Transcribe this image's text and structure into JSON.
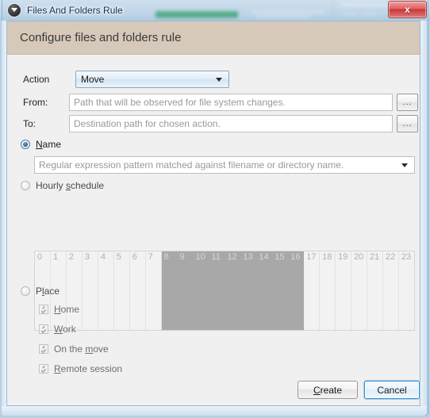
{
  "window": {
    "title": "Files And Folders Rule",
    "icon": "triangle-circle-icon",
    "close_label": "x"
  },
  "banner": {
    "heading": "Configure files and folders rule"
  },
  "form": {
    "action": {
      "label": "Action",
      "value": "Move",
      "options": [
        "Move"
      ]
    },
    "from": {
      "label": "From:",
      "value": "",
      "placeholder": "Path that will be observed for file system changes.",
      "browse_label": "..."
    },
    "to": {
      "label": "To:",
      "value": "",
      "placeholder": "Destination path for chosen action.",
      "browse_label": "..."
    }
  },
  "criteria": {
    "name": {
      "label": "Name",
      "mnemonic": "N",
      "selected": true,
      "pattern_value": "",
      "pattern_placeholder": "Regular expression pattern matched against filename or directory name."
    },
    "hourly": {
      "label_pre": "Hourly ",
      "mnemonic": "s",
      "label_post": "chedule",
      "selected": false,
      "hours": [
        "0",
        "1",
        "2",
        "3",
        "4",
        "5",
        "6",
        "7",
        "8",
        "9",
        "10",
        "11",
        "12",
        "13",
        "14",
        "15",
        "16",
        "17",
        "18",
        "19",
        "20",
        "21",
        "22",
        "23"
      ],
      "selected_hours": [
        8,
        9,
        10,
        11,
        12,
        13,
        14,
        15,
        16
      ]
    },
    "place": {
      "label_pre": "P",
      "mnemonic": "l",
      "label_post": "ace",
      "selected": false,
      "items": [
        {
          "label_pre": "",
          "mnemonic": "H",
          "label_post": "ome",
          "checked": true
        },
        {
          "label_pre": "",
          "mnemonic": "W",
          "label_post": "ork",
          "checked": true
        },
        {
          "label_pre": "On the ",
          "mnemonic": "m",
          "label_post": "ove",
          "checked": true
        },
        {
          "label_pre": "",
          "mnemonic": "R",
          "label_post": "emote session",
          "checked": true
        }
      ]
    }
  },
  "footer": {
    "create_pre": "",
    "create_mnemonic": "C",
    "create_post": "reate",
    "cancel_label": "Cancel"
  },
  "colors": {
    "banner": "#d7c9ba",
    "selected_hour": "#a8a8a8",
    "close_button": "#c83636",
    "focus_ring": "#3c8ccc"
  }
}
